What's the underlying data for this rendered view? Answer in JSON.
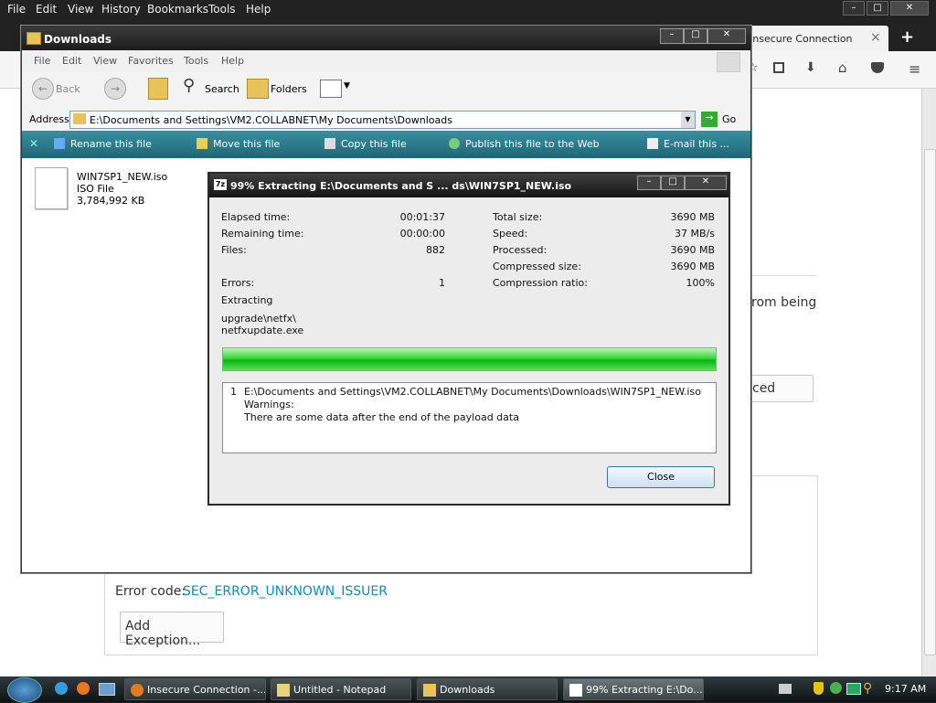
{
  "firefox": {
    "menu": [
      "File",
      "Edit",
      "View",
      "History",
      "Bookmarks",
      "Tools",
      "Help"
    ],
    "tab_title": "Insecure Connection",
    "tab_close": "×",
    "new_tab": "+",
    "page_text_partial": "rom being",
    "advanced_button_partial": "ced",
    "error_code_label": "Error code:",
    "error_code": "SEC_ERROR_UNKNOWN_ISSUER",
    "add_exception_label": "Add Exception..."
  },
  "explorer": {
    "title": "Downloads",
    "menu": [
      "File",
      "Edit",
      "View",
      "Favorites",
      "Tools",
      "Help"
    ],
    "toolbar": {
      "back": "Back",
      "search": "Search",
      "folders": "Folders"
    },
    "address_label": "Address",
    "address_value": "E:\\Documents and Settings\\VM2.COLLABNET\\My Documents\\Downloads",
    "go_label": "Go",
    "tasks": [
      "Rename this file",
      "Move this file",
      "Copy this file",
      "Publish this file to the Web",
      "E-mail this ..."
    ],
    "file": {
      "name": "WIN7SP1_NEW.iso",
      "type": "ISO File",
      "size": "3,784,992 KB"
    }
  },
  "zip": {
    "title": "99% Extracting E:\\Documents and S ... ds\\WIN7SP1_NEW.iso",
    "left": {
      "elapsed_label": "Elapsed time:",
      "elapsed": "00:01:37",
      "remaining_label": "Remaining time:",
      "remaining": "00:00:00",
      "files_label": "Files:",
      "files": "882",
      "errors_label": "Errors:",
      "errors": "1"
    },
    "right": {
      "total_label": "Total size:",
      "total": "3690 MB",
      "speed_label": "Speed:",
      "speed": "37 MB/s",
      "processed_label": "Processed:",
      "processed": "3690 MB",
      "compressed_label": "Compressed size:",
      "compressed": "3690 MB",
      "ratio_label": "Compression ratio:",
      "ratio": "100%"
    },
    "status": "Extracting",
    "current_file_1": "upgrade\\netfx\\",
    "current_file_2": "netfxupdate.exe",
    "progress_fraction": 0.99,
    "log": {
      "index": "1",
      "path": "E:\\Documents and Settings\\VM2.COLLABNET\\My Documents\\Downloads\\WIN7SP1_NEW.iso",
      "warnings": "Warnings:",
      "message": "There are some data after the end of the payload data"
    },
    "close_label": "Close"
  },
  "taskbar": {
    "buttons": [
      "Insecure Connection -...",
      "Untitled - Notepad",
      "Downloads",
      "99% Extracting E:\\Do..."
    ],
    "clock": "9:17 AM"
  }
}
